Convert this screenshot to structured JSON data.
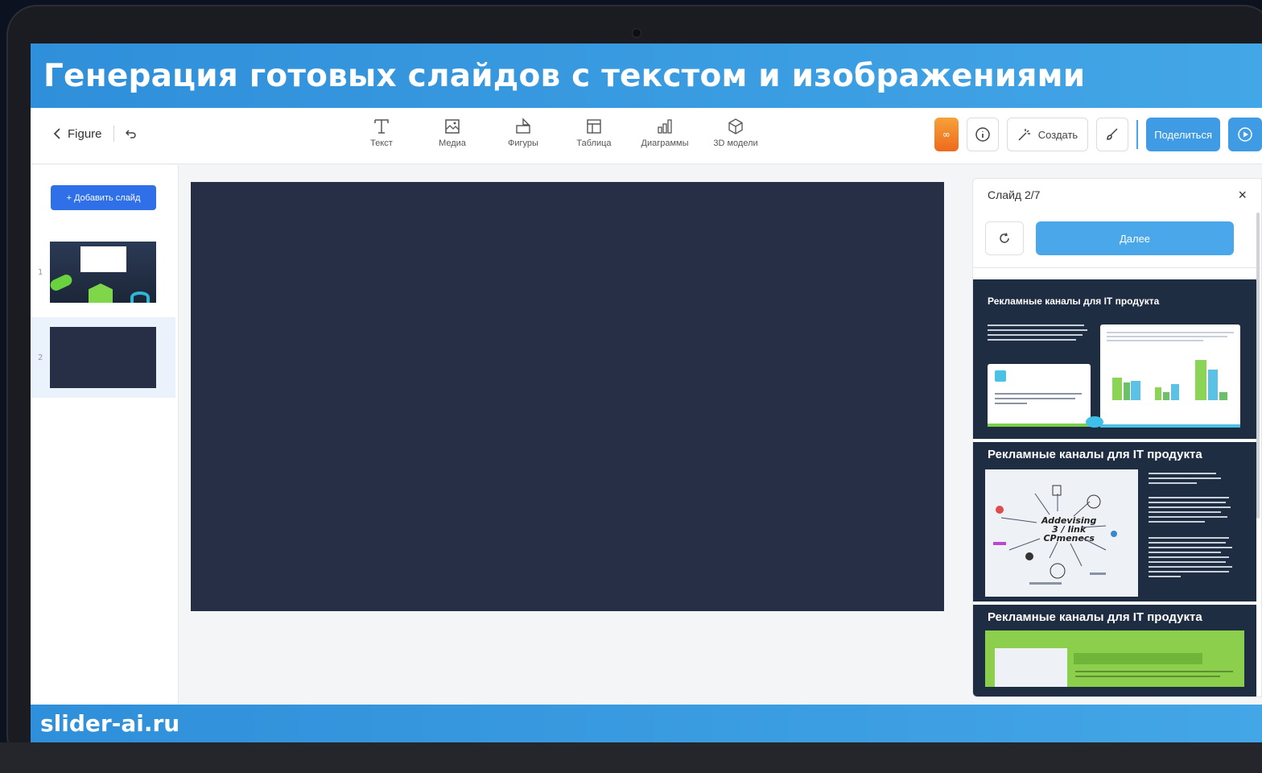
{
  "banner": {
    "title": "Генерация готовых слайдов с текстом и изображениями",
    "footer": "slider-ai.ru"
  },
  "toolbar": {
    "back_label": "Figure",
    "tools": [
      {
        "label": "Текст",
        "icon": "text-icon"
      },
      {
        "label": "Медиа",
        "icon": "image-icon"
      },
      {
        "label": "Фигуры",
        "icon": "shapes-icon"
      },
      {
        "label": "Таблица",
        "icon": "table-icon"
      },
      {
        "label": "Диаграммы",
        "icon": "chart-icon"
      },
      {
        "label": "3D модели",
        "icon": "cube-icon"
      }
    ],
    "badge": "∞",
    "create_label": "Создать",
    "share_label": "Поделиться"
  },
  "sidebar": {
    "add_slide_label": "+ Добавить слайд",
    "slides": [
      {
        "number": "1"
      },
      {
        "number": "2"
      }
    ]
  },
  "panel": {
    "title": "Слайд 2/7",
    "close_label": "×",
    "next_label": "Далее",
    "variants": [
      {
        "title": "Рекламные каналы для IT продукта"
      },
      {
        "title": "Рекламные каналы для IT продукта",
        "diagram_text": "Addevising\n3 / link\nCPmenecs"
      },
      {
        "title": "Рекламные каналы для IT продукта"
      }
    ]
  },
  "colors": {
    "banner": "#3a9be2",
    "slide_bg": "#262f45",
    "primary_button": "#2f6fe8",
    "share_button": "#3f9be3",
    "orange_badge": "#f08a2a"
  }
}
